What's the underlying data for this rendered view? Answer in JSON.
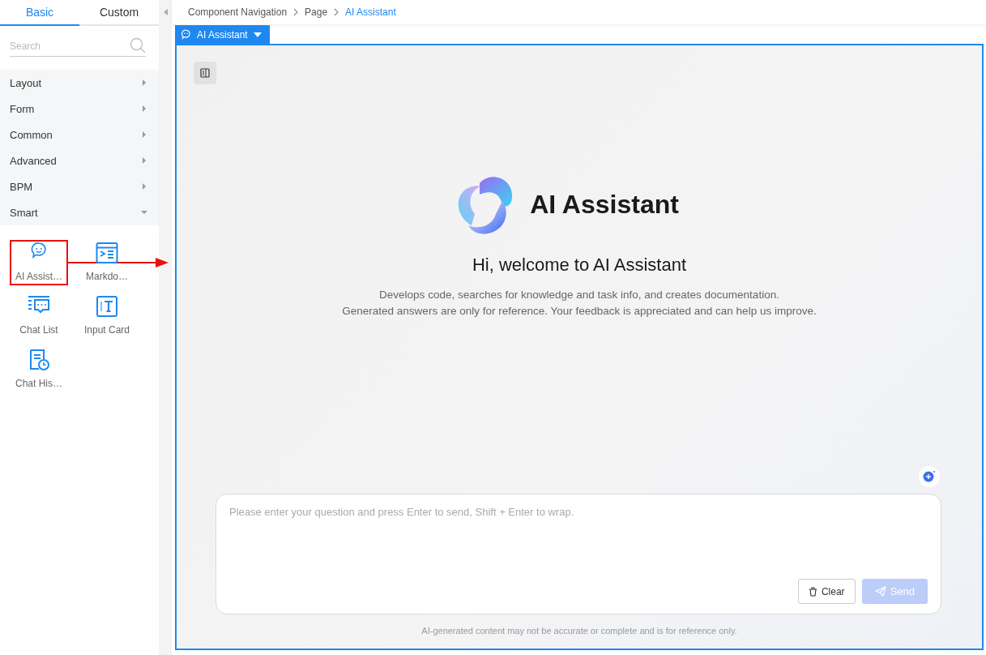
{
  "sidebar": {
    "tabs": [
      {
        "label": "Basic",
        "selected": true
      },
      {
        "label": "Custom",
        "selected": false
      }
    ],
    "search": {
      "placeholder": "Search"
    },
    "categories": [
      {
        "label": "Layout",
        "expanded": false
      },
      {
        "label": "Form",
        "expanded": false
      },
      {
        "label": "Common",
        "expanded": false
      },
      {
        "label": "Advanced",
        "expanded": false
      },
      {
        "label": "BPM",
        "expanded": false
      },
      {
        "label": "Smart",
        "expanded": true
      }
    ],
    "components": [
      {
        "label": "AI Assist…",
        "kind": "chat-bubble",
        "selected": true
      },
      {
        "label": "Markdo…",
        "kind": "markdown",
        "selected": false
      },
      {
        "label": "Chat List",
        "kind": "chat-list",
        "selected": false
      },
      {
        "label": "Input Card",
        "kind": "input-card",
        "selected": false
      },
      {
        "label": "Chat His…",
        "kind": "chat-history",
        "selected": false
      }
    ]
  },
  "breadcrumb": [
    {
      "label": "Component Navigation",
      "current": false
    },
    {
      "label": "Page",
      "current": false
    },
    {
      "label": "AI Assistant",
      "current": true
    }
  ],
  "canvas": {
    "component_tag": "AI Assistant",
    "assistant": {
      "brand": "AI Assistant",
      "heading": "Hi, welcome to AI Assistant",
      "description": [
        "Develops code, searches for knowledge and task info, and creates documentation.",
        "Generated answers are only for reference. Your feedback is appreciated and can help us improve."
      ],
      "input": {
        "placeholder": "Please enter your question and press Enter to send, Shift + Enter to wrap."
      },
      "buttons": [
        {
          "label": "Clear",
          "kind": "clear",
          "disabled": false
        },
        {
          "label": "Send",
          "kind": "send",
          "disabled": true
        }
      ],
      "disclaimer": "AI-generated content may not be accurate or complete and is for reference only."
    }
  }
}
